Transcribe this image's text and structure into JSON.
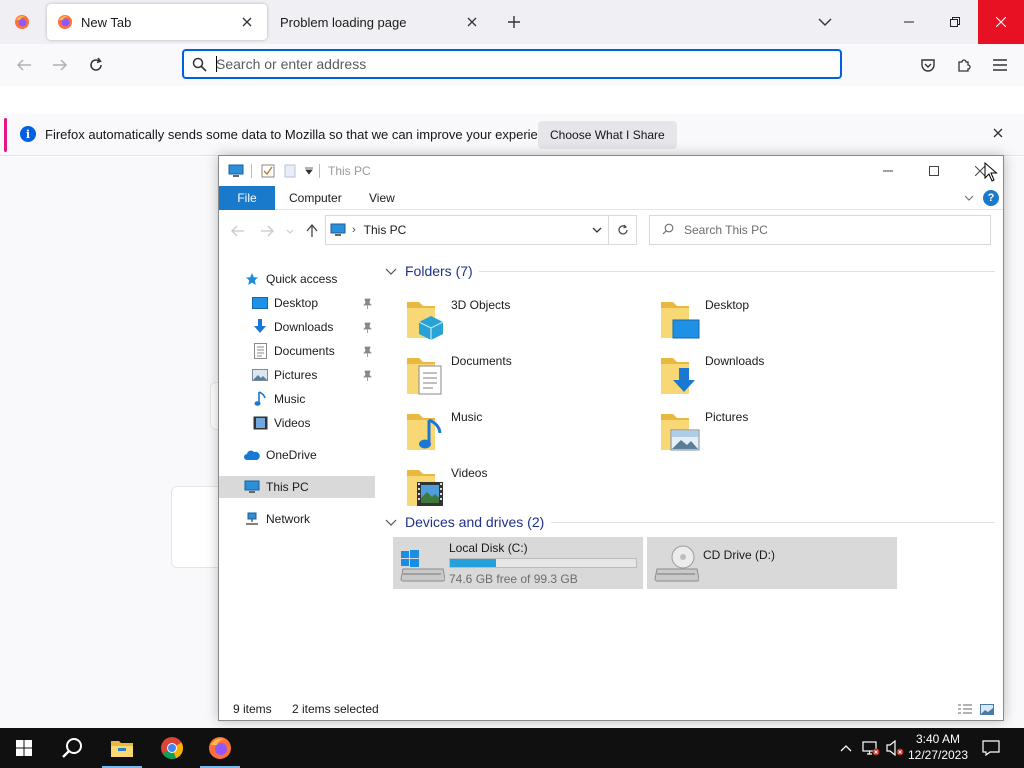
{
  "browser": {
    "tabs": [
      {
        "title": "New Tab",
        "active": true
      },
      {
        "title": "Problem loading page",
        "active": false
      }
    ],
    "urlbar": {
      "placeholder": "Search or enter address",
      "value": ""
    },
    "notification": {
      "text": "Firefox automatically sends some data to Mozilla so that we can improve your experience.",
      "button": "Choose What I Share"
    },
    "icons": [
      "firefox-logo-icon",
      "close-icon",
      "plus-icon",
      "chevron-down-icon",
      "back-arrow-icon",
      "forward-arrow-icon",
      "reload-icon",
      "pocket-icon",
      "extensions-icon",
      "menu-icon"
    ]
  },
  "explorer": {
    "title": "This PC",
    "ribbon_tabs": [
      "File",
      "Computer",
      "View"
    ],
    "address": {
      "crumb_sep": "›",
      "location": "This PC"
    },
    "search_placeholder": "Search This PC",
    "nav": {
      "items": [
        {
          "label": "Quick access",
          "icon": "star-icon"
        },
        {
          "label": "Desktop",
          "icon": "desktop-icon",
          "pinned": true
        },
        {
          "label": "Downloads",
          "icon": "download-icon",
          "pinned": true
        },
        {
          "label": "Documents",
          "icon": "document-icon",
          "pinned": true
        },
        {
          "label": "Pictures",
          "icon": "picture-icon",
          "pinned": true
        },
        {
          "label": "Music",
          "icon": "music-icon"
        },
        {
          "label": "Videos",
          "icon": "video-icon"
        },
        {
          "label": "OneDrive",
          "icon": "cloud-icon"
        },
        {
          "label": "This PC",
          "icon": "computer-icon",
          "selected": true
        },
        {
          "label": "Network",
          "icon": "network-icon"
        }
      ]
    },
    "folders_group": {
      "label": "Folders (7)"
    },
    "folders": [
      {
        "name": "3D Objects"
      },
      {
        "name": "Desktop"
      },
      {
        "name": "Documents"
      },
      {
        "name": "Downloads"
      },
      {
        "name": "Music"
      },
      {
        "name": "Pictures"
      },
      {
        "name": "Videos"
      }
    ],
    "drives_group": {
      "label": "Devices and drives (2)"
    },
    "drives": [
      {
        "name": "Local Disk (C:)",
        "free_text": "74.6 GB free of 99.3 GB",
        "used_fraction": 0.249
      },
      {
        "name": "CD Drive (D:)"
      }
    ],
    "status": {
      "items": "9 items",
      "selected": "2 items selected"
    },
    "colors": {
      "accent": "#1979ca",
      "selection": "#d9d9d9",
      "capacity_bar": "#26a0da"
    }
  },
  "taskbar": {
    "time": "3:40 AM",
    "date": "12/27/2023",
    "apps": [
      "windows-start-icon",
      "search-icon",
      "file-explorer-icon",
      "chrome-icon",
      "firefox-icon"
    ]
  }
}
